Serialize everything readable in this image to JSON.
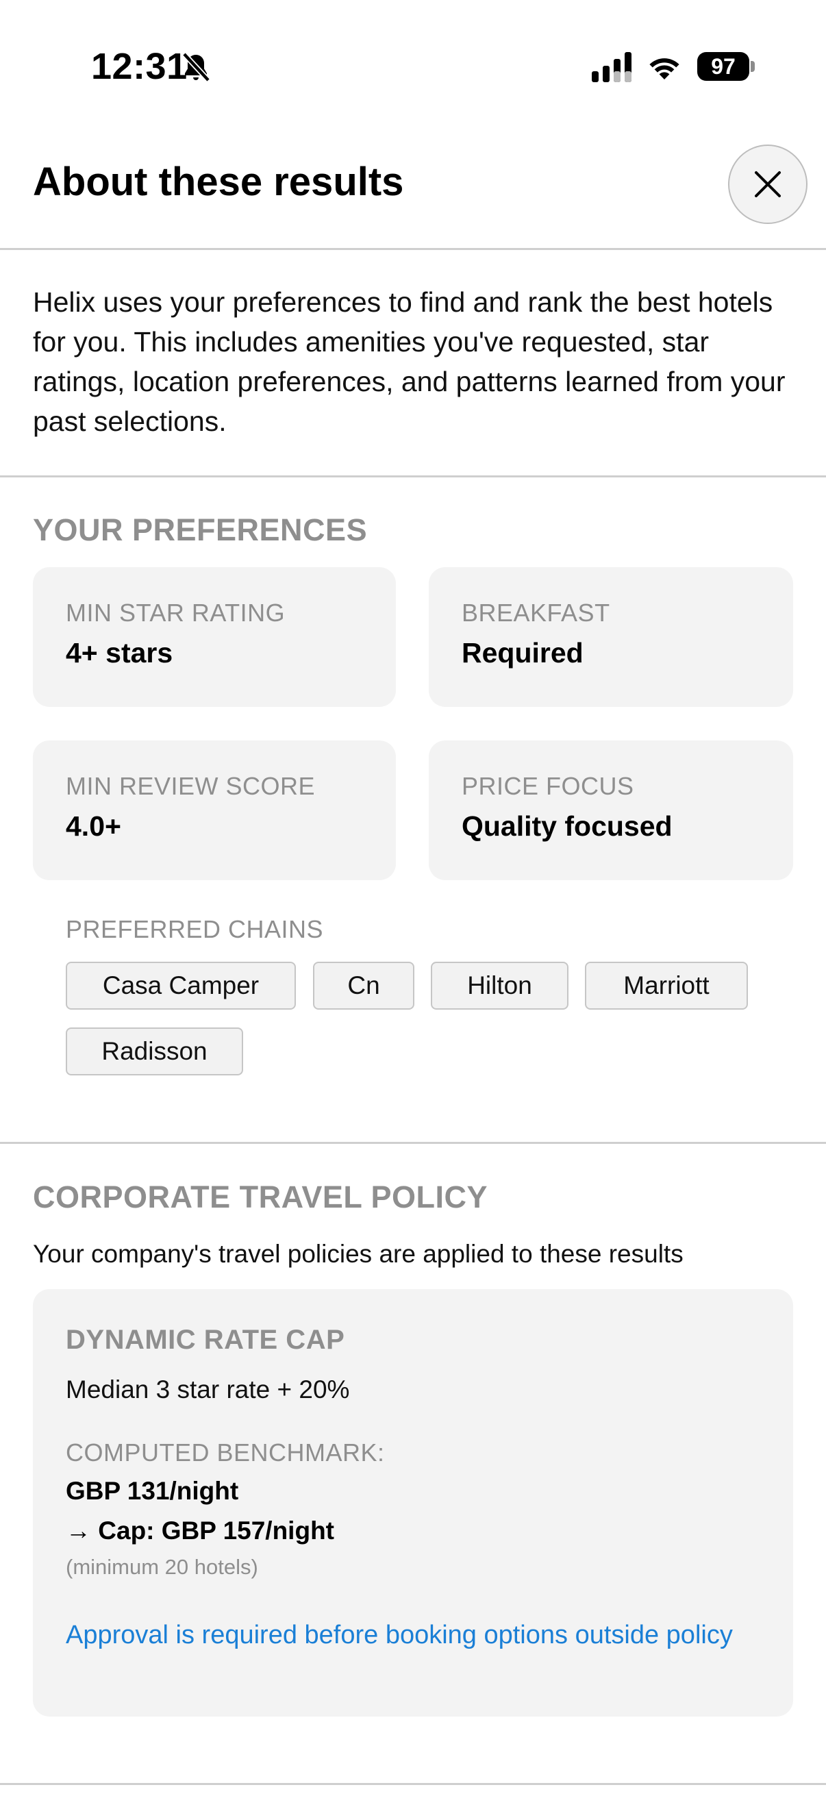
{
  "status_bar": {
    "time": "12:31",
    "battery": "97",
    "icons": [
      "bell-slash-icon",
      "cellular-signal-icon",
      "wifi-icon",
      "battery-icon"
    ]
  },
  "header": {
    "title": "About these results",
    "close_icon": "close-icon"
  },
  "intro": "Helix uses your preferences to find and rank the best hotels for you. This includes amenities you've requested, star ratings, location preferences, and patterns learned from your past selections.",
  "preferences": {
    "title": "YOUR PREFERENCES",
    "cards": [
      {
        "label": "MIN STAR RATING",
        "value": "4+ stars"
      },
      {
        "label": "BREAKFAST",
        "value": "Required"
      },
      {
        "label": "MIN REVIEW SCORE",
        "value": "4.0+"
      },
      {
        "label": "PRICE FOCUS",
        "value": "Quality focused"
      }
    ],
    "chains_label": "PREFERRED CHAINS",
    "chains": [
      "Casa Camper",
      "Cn",
      "Hilton",
      "Marriott",
      "Radisson"
    ]
  },
  "policy": {
    "title": "CORPORATE TRAVEL POLICY",
    "subtitle": "Your company's travel policies are applied to these results",
    "rate_cap_title": "DYNAMIC RATE CAP",
    "rate_cap_desc": "Median 3 star rate + 20%",
    "benchmark_label": "COMPUTED BENCHMARK:",
    "benchmark_value": "GBP 131/night",
    "cap_value": "→ Cap: GBP 157/night",
    "min_hotels": "(minimum 20 hotels)",
    "approval_link": "Approval is required before booking options outside policy"
  },
  "colors": {
    "link": "#1a7fd6",
    "muted": "#8e8e8e",
    "card_bg": "#f3f3f3"
  }
}
